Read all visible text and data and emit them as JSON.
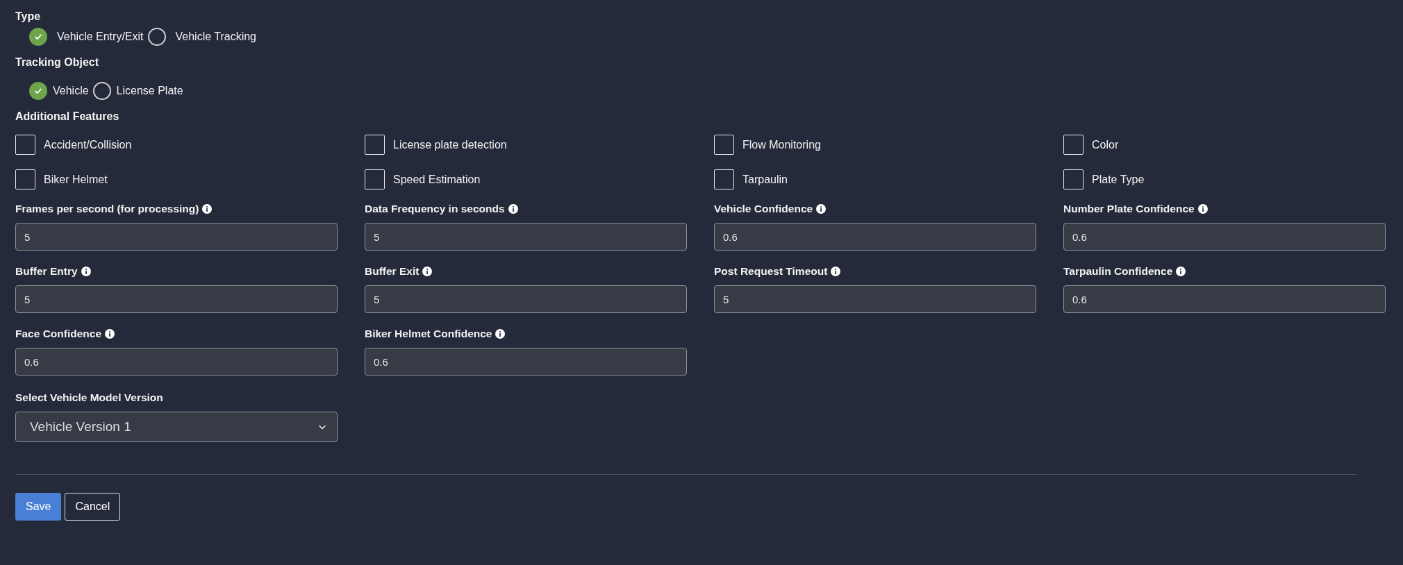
{
  "type_group": {
    "label": "Type",
    "options": [
      {
        "label": "Vehicle Entry/Exit",
        "selected": true
      },
      {
        "label": "Vehicle Tracking",
        "selected": false
      }
    ]
  },
  "tracking_object": {
    "label": "Tracking Object",
    "options": [
      {
        "label": "Vehicle",
        "selected": true
      },
      {
        "label": "License Plate",
        "selected": false
      }
    ]
  },
  "additional_features": {
    "label": "Additional Features",
    "items": [
      {
        "label": "Accident/Collision",
        "checked": false
      },
      {
        "label": "License plate detection",
        "checked": false
      },
      {
        "label": "Flow Monitoring",
        "checked": false
      },
      {
        "label": "Color",
        "checked": false
      },
      {
        "label": "Biker Helmet",
        "checked": false
      },
      {
        "label": "Speed Estimation",
        "checked": false
      },
      {
        "label": "Tarpaulin",
        "checked": false
      },
      {
        "label": "Plate Type",
        "checked": false
      }
    ]
  },
  "fields": [
    {
      "label": "Frames per second (for processing)",
      "value": "5"
    },
    {
      "label": "Data Frequency in seconds",
      "value": "5"
    },
    {
      "label": "Vehicle Confidence",
      "value": "0.6"
    },
    {
      "label": "Number Plate Confidence",
      "value": "0.6"
    },
    {
      "label": "Buffer Entry",
      "value": "5"
    },
    {
      "label": "Buffer Exit",
      "value": "5"
    },
    {
      "label": "Post Request Timeout",
      "value": "5"
    },
    {
      "label": "Tarpaulin Confidence",
      "value": "0.6"
    },
    {
      "label": "Face Confidence",
      "value": "0.6"
    },
    {
      "label": "Biker Helmet Confidence",
      "value": "0.6"
    }
  ],
  "model_select": {
    "label": "Select Vehicle Model Version",
    "value": "Vehicle Version 1"
  },
  "buttons": [
    {
      "label": "Save",
      "kind": "primary"
    },
    {
      "label": "Cancel",
      "kind": "secondary"
    }
  ]
}
